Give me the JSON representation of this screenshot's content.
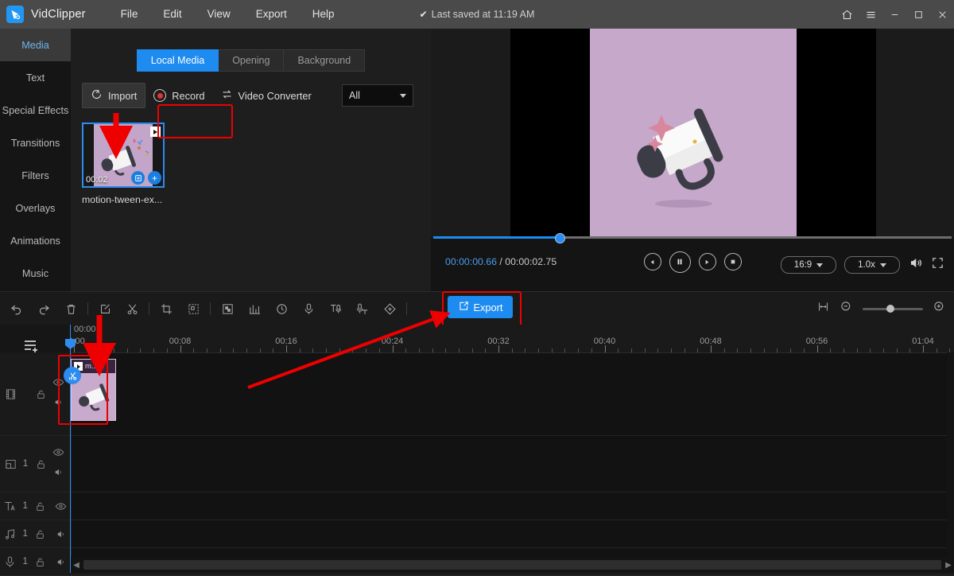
{
  "titlebar": {
    "app_name": "VidClipper",
    "menus": [
      "File",
      "Edit",
      "View",
      "Export",
      "Help"
    ],
    "saved_status": "Last saved at 11:19 AM",
    "check_glyph": "✔",
    "home_icon": "home-icon",
    "hamburger_icon": "hamburger-icon",
    "minimize_icon": "minimize-icon",
    "maximize_icon": "maximize-icon",
    "close_icon": "close-icon",
    "accent": "#2196f3"
  },
  "rail": {
    "items": [
      {
        "label": "Media",
        "active": true
      },
      {
        "label": "Text",
        "active": false
      },
      {
        "label": "Special Effects",
        "active": false
      },
      {
        "label": "Transitions",
        "active": false
      },
      {
        "label": "Filters",
        "active": false
      },
      {
        "label": "Overlays",
        "active": false
      },
      {
        "label": "Animations",
        "active": false
      },
      {
        "label": "Music",
        "active": false
      }
    ]
  },
  "media_panel": {
    "tabs": [
      {
        "label": "Local Media",
        "active": true
      },
      {
        "label": "Opening",
        "active": false
      },
      {
        "label": "Background",
        "active": false
      }
    ],
    "tools": [
      {
        "label": "Import",
        "icon": "import-icon",
        "highlighted": true
      },
      {
        "label": "Record",
        "icon": "record-icon",
        "highlighted": false
      },
      {
        "label": "Video Converter",
        "icon": "convert-icon",
        "highlighted": false
      }
    ],
    "filter": {
      "value": "All",
      "icon": "chevron-down-icon"
    },
    "items": [
      {
        "name": "motion-tween-ex...",
        "duration": "00:02",
        "badge_icon": "play-badge-icon",
        "actions": [
          "add-to-track-icon",
          "plus-icon"
        ]
      }
    ]
  },
  "preview": {
    "current_time": "00:00:00.66",
    "separator": "/",
    "total_time": "00:00:02.75",
    "progress_percent": 24,
    "controls": [
      {
        "name": "previous-frame-button",
        "icon": "step-back-icon"
      },
      {
        "name": "pause-button",
        "icon": "pause-icon"
      },
      {
        "name": "next-frame-button",
        "icon": "step-forward-icon"
      },
      {
        "name": "stop-button",
        "icon": "stop-icon"
      }
    ],
    "aspect_ratio": "16:9",
    "playback_speed": "1.0x",
    "volume_icon": "volume-icon",
    "fullscreen_icon": "fullscreen-icon"
  },
  "timeline_toolbar": {
    "left_icons": [
      {
        "name": "undo-icon"
      },
      {
        "name": "redo-icon"
      },
      {
        "name": "delete-icon"
      },
      {
        "name": "edit-icon"
      },
      {
        "name": "split-icon"
      },
      {
        "name": "crop-icon"
      },
      {
        "name": "mask-icon"
      },
      {
        "name": "mosaic-icon"
      },
      {
        "name": "audio-waveform-icon"
      },
      {
        "name": "speed-icon"
      },
      {
        "name": "voiceover-icon"
      },
      {
        "name": "text-to-speech-icon"
      },
      {
        "name": "speech-to-text-icon"
      },
      {
        "name": "keyframe-icon"
      }
    ],
    "export_label": "Export",
    "export_icon": "export-icon",
    "export_color": "#1e8bf0",
    "fit_icon": "fit-timeline-icon",
    "zoom_out_icon": "zoom-out-icon",
    "zoom_in_icon": "zoom-in-icon",
    "zoom_value_percent": 40
  },
  "timeline": {
    "add_track_icon": "add-track-icon",
    "ruler_labels": [
      "00:00",
      "00:08",
      "00:16",
      "00:24",
      "00:32",
      "00:40",
      "00:48",
      "00:56",
      "01:04"
    ],
    "playhead_time": "00:00",
    "tracks": [
      {
        "type": "video",
        "icon": "film-icon",
        "count": "",
        "lock_icon": "unlock-icon",
        "eye_icon": "eye-icon",
        "sound_icon": "speaker-icon"
      },
      {
        "type": "overlay",
        "icon": "pip-icon",
        "count": "1",
        "lock_icon": "unlock-icon",
        "eye_icon": "eye-icon",
        "sound_icon": "speaker-icon"
      },
      {
        "type": "text",
        "icon": "text-icon",
        "count": "1",
        "lock_icon": "unlock-icon",
        "eye_icon": "eye-icon",
        "sound_icon": ""
      },
      {
        "type": "music",
        "icon": "music-icon",
        "count": "1",
        "lock_icon": "unlock-icon",
        "eye_icon": "",
        "sound_icon": "speaker-icon"
      },
      {
        "type": "voice",
        "icon": "mic-icon",
        "count": "1",
        "lock_icon": "unlock-icon",
        "eye_icon": "",
        "sound_icon": "speaker-icon"
      }
    ],
    "clip": {
      "name": "m...",
      "badge_icon": "play-badge-icon",
      "split_icon": "scissors-icon"
    },
    "scroll_left_icon": "chevron-left-icon",
    "scroll_right_icon": "chevron-right-icon"
  },
  "annotations": {
    "highlight_color": "#ee0000",
    "markers": [
      "import-button-highlight",
      "media-thumbnail-arrow",
      "timeline-clip-highlight",
      "export-button-highlight",
      "export-arrow"
    ]
  }
}
